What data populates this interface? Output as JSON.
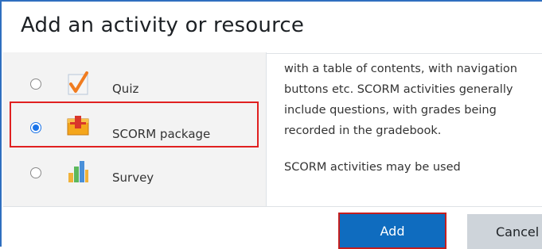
{
  "dialog": {
    "title": "Add an activity or resource"
  },
  "options": [
    {
      "label": "Quiz",
      "icon": "quiz-checkmark-icon",
      "selected": false
    },
    {
      "label": "SCORM package",
      "icon": "scorm-package-icon",
      "selected": true
    },
    {
      "label": "Survey",
      "icon": "survey-chart-icon",
      "selected": false
    }
  ],
  "description": {
    "paragraph1": "with a table of contents, with navigation buttons etc. SCORM activities generally include questions, with grades being recorded in the gradebook.",
    "paragraph2": "SCORM activities may be used"
  },
  "footer": {
    "add_label": "Add",
    "cancel_label": "Cancel"
  },
  "colors": {
    "primary": "#0f6cbf",
    "highlight": "#e02020",
    "secondary": "#ced4da"
  }
}
